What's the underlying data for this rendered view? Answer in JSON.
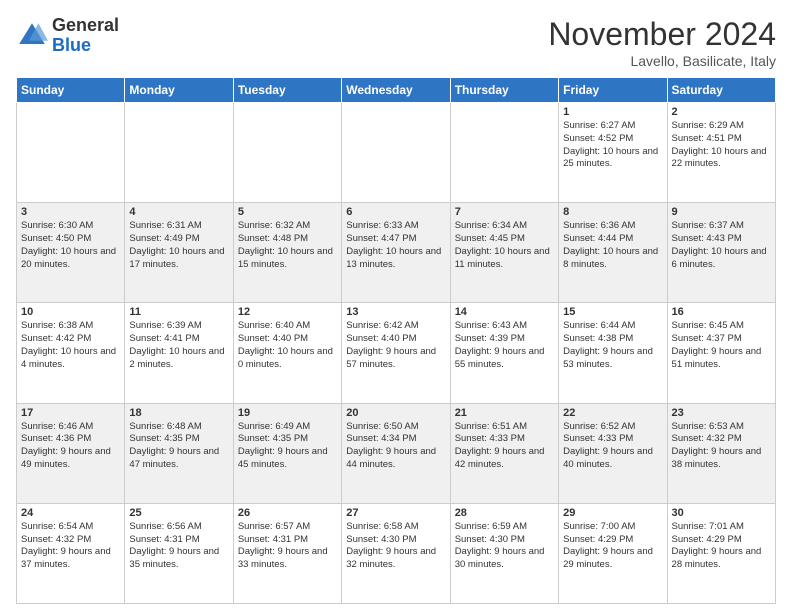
{
  "logo": {
    "general": "General",
    "blue": "Blue"
  },
  "title": "November 2024",
  "location": "Lavello, Basilicate, Italy",
  "days_of_week": [
    "Sunday",
    "Monday",
    "Tuesday",
    "Wednesday",
    "Thursday",
    "Friday",
    "Saturday"
  ],
  "weeks": [
    [
      {
        "day": "",
        "info": ""
      },
      {
        "day": "",
        "info": ""
      },
      {
        "day": "",
        "info": ""
      },
      {
        "day": "",
        "info": ""
      },
      {
        "day": "",
        "info": ""
      },
      {
        "day": "1",
        "info": "Sunrise: 6:27 AM\nSunset: 4:52 PM\nDaylight: 10 hours and 25 minutes."
      },
      {
        "day": "2",
        "info": "Sunrise: 6:29 AM\nSunset: 4:51 PM\nDaylight: 10 hours and 22 minutes."
      }
    ],
    [
      {
        "day": "3",
        "info": "Sunrise: 6:30 AM\nSunset: 4:50 PM\nDaylight: 10 hours and 20 minutes."
      },
      {
        "day": "4",
        "info": "Sunrise: 6:31 AM\nSunset: 4:49 PM\nDaylight: 10 hours and 17 minutes."
      },
      {
        "day": "5",
        "info": "Sunrise: 6:32 AM\nSunset: 4:48 PM\nDaylight: 10 hours and 15 minutes."
      },
      {
        "day": "6",
        "info": "Sunrise: 6:33 AM\nSunset: 4:47 PM\nDaylight: 10 hours and 13 minutes."
      },
      {
        "day": "7",
        "info": "Sunrise: 6:34 AM\nSunset: 4:45 PM\nDaylight: 10 hours and 11 minutes."
      },
      {
        "day": "8",
        "info": "Sunrise: 6:36 AM\nSunset: 4:44 PM\nDaylight: 10 hours and 8 minutes."
      },
      {
        "day": "9",
        "info": "Sunrise: 6:37 AM\nSunset: 4:43 PM\nDaylight: 10 hours and 6 minutes."
      }
    ],
    [
      {
        "day": "10",
        "info": "Sunrise: 6:38 AM\nSunset: 4:42 PM\nDaylight: 10 hours and 4 minutes."
      },
      {
        "day": "11",
        "info": "Sunrise: 6:39 AM\nSunset: 4:41 PM\nDaylight: 10 hours and 2 minutes."
      },
      {
        "day": "12",
        "info": "Sunrise: 6:40 AM\nSunset: 4:40 PM\nDaylight: 10 hours and 0 minutes."
      },
      {
        "day": "13",
        "info": "Sunrise: 6:42 AM\nSunset: 4:40 PM\nDaylight: 9 hours and 57 minutes."
      },
      {
        "day": "14",
        "info": "Sunrise: 6:43 AM\nSunset: 4:39 PM\nDaylight: 9 hours and 55 minutes."
      },
      {
        "day": "15",
        "info": "Sunrise: 6:44 AM\nSunset: 4:38 PM\nDaylight: 9 hours and 53 minutes."
      },
      {
        "day": "16",
        "info": "Sunrise: 6:45 AM\nSunset: 4:37 PM\nDaylight: 9 hours and 51 minutes."
      }
    ],
    [
      {
        "day": "17",
        "info": "Sunrise: 6:46 AM\nSunset: 4:36 PM\nDaylight: 9 hours and 49 minutes."
      },
      {
        "day": "18",
        "info": "Sunrise: 6:48 AM\nSunset: 4:35 PM\nDaylight: 9 hours and 47 minutes."
      },
      {
        "day": "19",
        "info": "Sunrise: 6:49 AM\nSunset: 4:35 PM\nDaylight: 9 hours and 45 minutes."
      },
      {
        "day": "20",
        "info": "Sunrise: 6:50 AM\nSunset: 4:34 PM\nDaylight: 9 hours and 44 minutes."
      },
      {
        "day": "21",
        "info": "Sunrise: 6:51 AM\nSunset: 4:33 PM\nDaylight: 9 hours and 42 minutes."
      },
      {
        "day": "22",
        "info": "Sunrise: 6:52 AM\nSunset: 4:33 PM\nDaylight: 9 hours and 40 minutes."
      },
      {
        "day": "23",
        "info": "Sunrise: 6:53 AM\nSunset: 4:32 PM\nDaylight: 9 hours and 38 minutes."
      }
    ],
    [
      {
        "day": "24",
        "info": "Sunrise: 6:54 AM\nSunset: 4:32 PM\nDaylight: 9 hours and 37 minutes."
      },
      {
        "day": "25",
        "info": "Sunrise: 6:56 AM\nSunset: 4:31 PM\nDaylight: 9 hours and 35 minutes."
      },
      {
        "day": "26",
        "info": "Sunrise: 6:57 AM\nSunset: 4:31 PM\nDaylight: 9 hours and 33 minutes."
      },
      {
        "day": "27",
        "info": "Sunrise: 6:58 AM\nSunset: 4:30 PM\nDaylight: 9 hours and 32 minutes."
      },
      {
        "day": "28",
        "info": "Sunrise: 6:59 AM\nSunset: 4:30 PM\nDaylight: 9 hours and 30 minutes."
      },
      {
        "day": "29",
        "info": "Sunrise: 7:00 AM\nSunset: 4:29 PM\nDaylight: 9 hours and 29 minutes."
      },
      {
        "day": "30",
        "info": "Sunrise: 7:01 AM\nSunset: 4:29 PM\nDaylight: 9 hours and 28 minutes."
      }
    ]
  ]
}
